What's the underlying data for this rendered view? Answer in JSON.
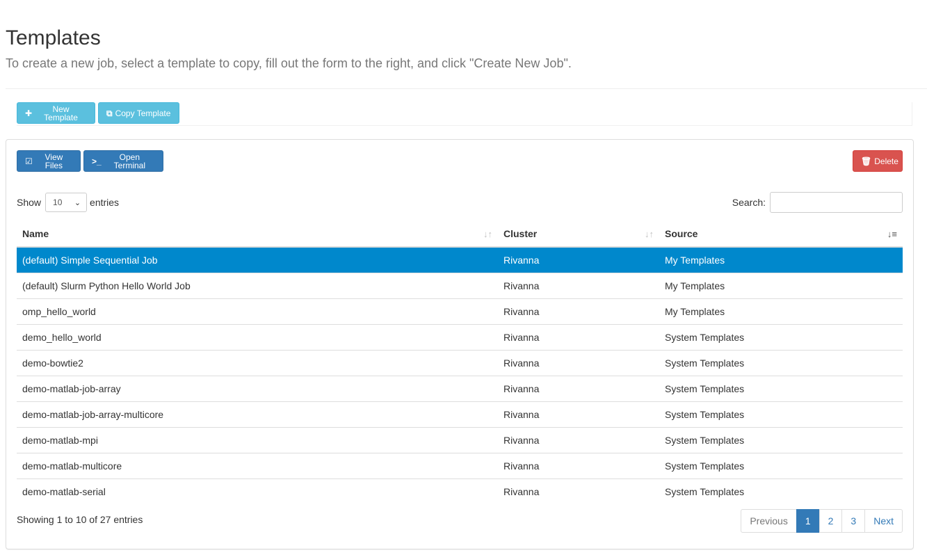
{
  "header": {
    "title": "Templates",
    "subtitle": "To create a new job, select a template to copy, fill out the form to the right, and click \"Create New Job\"."
  },
  "toolbar": {
    "new_template_label": "New Template",
    "copy_template_label": "Copy Template"
  },
  "panel": {
    "view_files_label": "View Files",
    "open_terminal_label": "Open Terminal",
    "delete_label": "Delete"
  },
  "table_controls": {
    "show_label": "Show",
    "page_length": "10",
    "entries_label": "entries",
    "search_label": "Search:",
    "search_value": ""
  },
  "table": {
    "columns": [
      "Name",
      "Cluster",
      "Source"
    ],
    "rows": [
      [
        "(default) Simple Sequential Job",
        "Rivanna",
        "My Templates"
      ],
      [
        "(default) Slurm Python Hello World Job",
        "Rivanna",
        "My Templates"
      ],
      [
        "omp_hello_world",
        "Rivanna",
        "My Templates"
      ],
      [
        "demo_hello_world",
        "Rivanna",
        "System Templates"
      ],
      [
        "demo-bowtie2",
        "Rivanna",
        "System Templates"
      ],
      [
        "demo-matlab-job-array",
        "Rivanna",
        "System Templates"
      ],
      [
        "demo-matlab-job-array-multicore",
        "Rivanna",
        "System Templates"
      ],
      [
        "demo-matlab-mpi",
        "Rivanna",
        "System Templates"
      ],
      [
        "demo-matlab-multicore",
        "Rivanna",
        "System Templates"
      ],
      [
        "demo-matlab-serial",
        "Rivanna",
        "System Templates"
      ]
    ],
    "selected_row": 0
  },
  "footer": {
    "info": "Showing 1 to 10 of 27 entries",
    "pagination": [
      "Previous",
      "1",
      "2",
      "3",
      "Next"
    ],
    "active_page": "1"
  },
  "icons": {
    "new_template": "plus-icon",
    "copy_template": "copy-icon",
    "view_files": "edit-icon",
    "open_terminal": "terminal-icon",
    "delete": "trash-icon"
  },
  "colors": {
    "info": "#5bc0de",
    "primary": "#337ab7",
    "danger": "#d9534f",
    "selected_row": "#0088cc"
  }
}
